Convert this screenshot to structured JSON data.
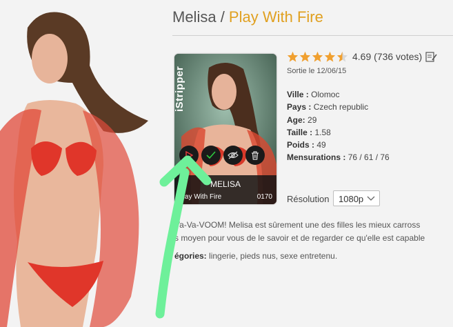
{
  "header": {
    "model": "Melisa",
    "separator": " / ",
    "scene": "Play With Fire"
  },
  "card": {
    "brand": "iStripper",
    "model_label": "MELISA",
    "scene_label": "Play With Fire",
    "number": "0170",
    "actions": [
      "play-icon",
      "check-icon",
      "hide-icon",
      "trash-icon"
    ]
  },
  "rating": {
    "stars": 4.5,
    "text": "4.69 (736 votes)"
  },
  "release": "Sortie le 12/06/15",
  "info": {
    "city_label": "Ville :",
    "city": "Olomoc",
    "country_label": "Pays :",
    "country": "Czech republic",
    "age_label": "Age:",
    "age": "29",
    "height_label": "Taille :",
    "height": "1.58",
    "weight_label": "Poids :",
    "weight": "49",
    "measurements_label": "Mensurations :",
    "measurements": "76 / 61 / 76"
  },
  "resolution": {
    "label": "Résolution",
    "value": "1080p"
  },
  "description": {
    "line1": "Va-Va-VOOM! Melisa est sûrement une des filles les mieux carross",
    "line2": "s moyen pour vous de le savoir et de regarder ce qu'elle est capable"
  },
  "categories": {
    "label": "égories:",
    "value": "lingerie, pieds nus, sexe entretenu."
  },
  "colors": {
    "accent": "#e0a020",
    "star": "#f0a030",
    "arrow": "#6ef09a"
  }
}
